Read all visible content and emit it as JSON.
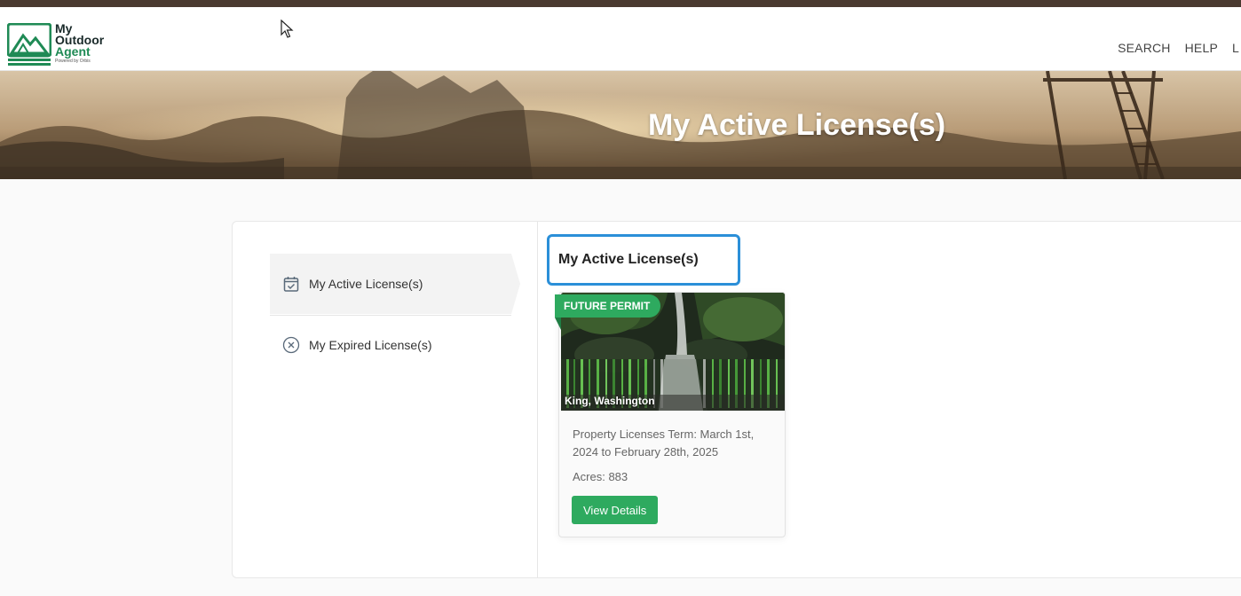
{
  "brand": {
    "line1": "My",
    "line2": "Outdoor",
    "line3": "Agent",
    "tagline": "Powered by Orbis"
  },
  "nav": {
    "items": [
      "SEARCH",
      "HELP",
      "L"
    ]
  },
  "hero": {
    "title": "My Active License(s)"
  },
  "sidebar": {
    "items": [
      {
        "label": "My Active License(s)",
        "icon": "calendar-check-icon",
        "active": true
      },
      {
        "label": "My Expired License(s)",
        "icon": "circle-x-icon",
        "active": false
      }
    ]
  },
  "main": {
    "section_title": "My Active License(s)",
    "licenses": [
      {
        "badge": "FUTURE PERMIT",
        "location": "King, Washington",
        "term": "Property Licenses Term: March 1st, 2024 to February 28th, 2025",
        "acres": "Acres: 883",
        "button": "View Details"
      }
    ]
  },
  "colors": {
    "accent_green": "#2eaa5f",
    "highlight_blue": "#2b8fd8",
    "topbar": "#4a3a30"
  }
}
